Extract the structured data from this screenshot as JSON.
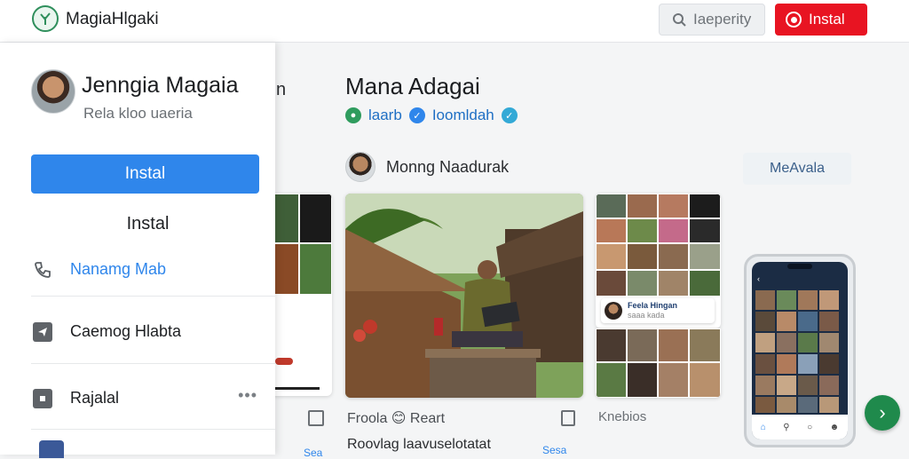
{
  "app": {
    "title": "MagiaHlgaki"
  },
  "topbar": {
    "search_label": "Iaeperity",
    "install_label": "Instal"
  },
  "sidebar": {
    "profile_name": "Jenngia Magaia",
    "profile_sub": "Rela kloo uaeria",
    "primary_button": "Instal",
    "secondary_button": "Instal",
    "items": [
      {
        "label": "Nanamg Mab",
        "icon": "phone-icon",
        "color": "#2f86eb"
      },
      {
        "label": "Caemog Hlabta",
        "icon": "send-icon",
        "color": "#1d1f22"
      },
      {
        "label": "Rajalal",
        "icon": "square-icon",
        "color": "#1d1f22",
        "more": "•••"
      }
    ]
  },
  "main": {
    "left_fragment": "n",
    "title": "Mana Adagai",
    "tags": [
      {
        "label": "laarb",
        "color": "#2f9c5e"
      },
      {
        "label": "Ioomldah",
        "color": "#2f86eb"
      }
    ],
    "poster_name": "Monng Naadurak",
    "follow_label": "MeAvala",
    "mini_label": "Feela Hingan",
    "mini_label_sub": "saaa kada",
    "footer_react": "Froola 😊 Reart",
    "footer_caption": "Roovlag laavuselotatat",
    "footer_link": "Sesa",
    "footer_link_left": "Sea",
    "footer_right": "Knebios"
  },
  "colors": {
    "accent_blue": "#2f86eb",
    "install_red": "#e81422",
    "fab_green": "#1f8a4c"
  }
}
